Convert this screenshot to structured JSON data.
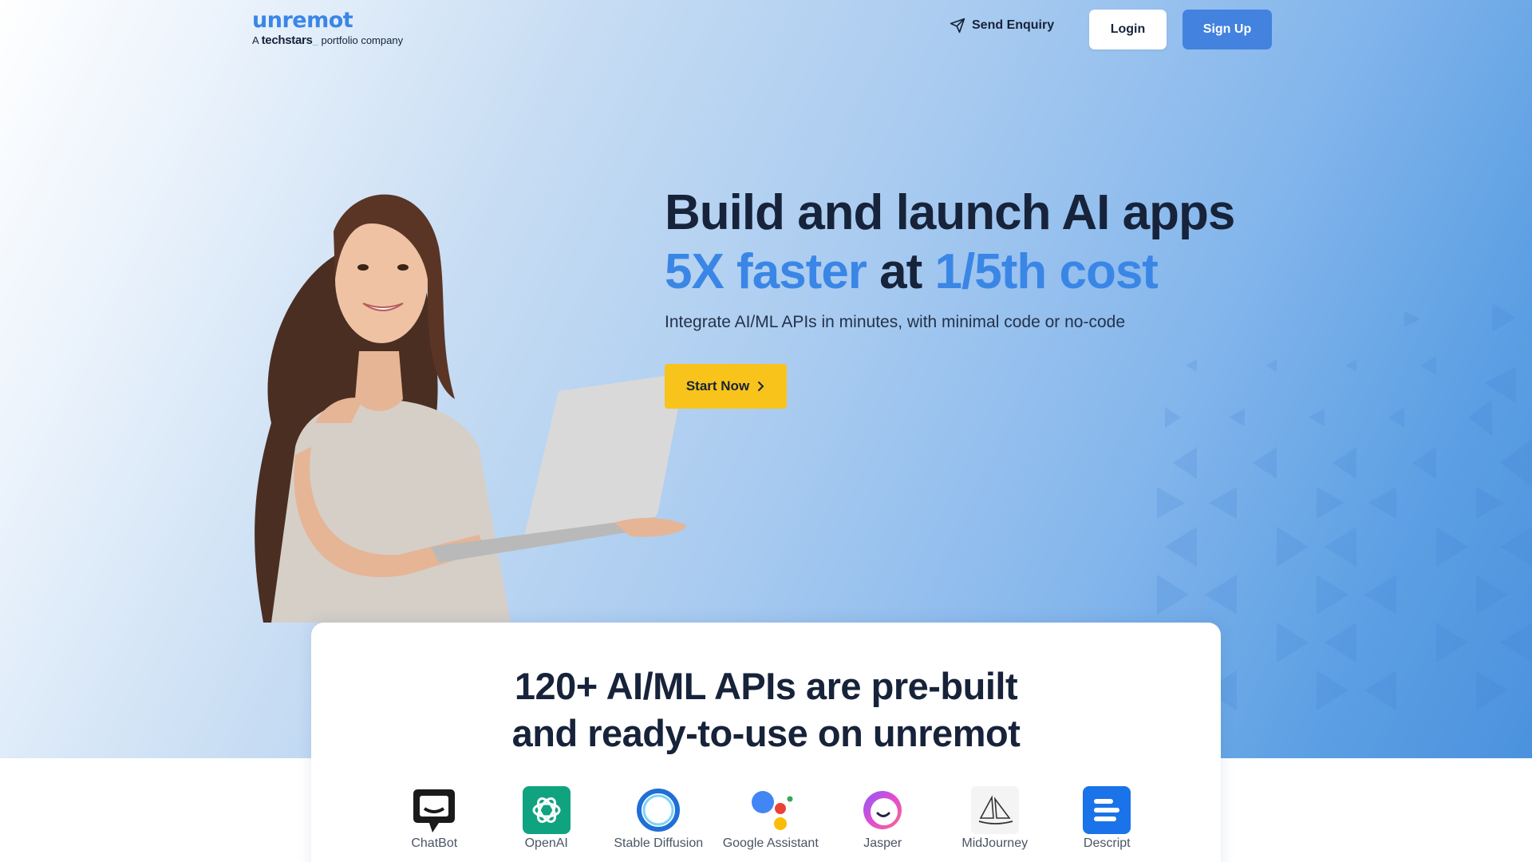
{
  "header": {
    "logo_word": "unremot",
    "logo_prefix": "A",
    "logo_techstars": "techstars",
    "logo_suffix": "portfolio company",
    "send_enquiry": "Send Enquiry",
    "login": "Login",
    "signup": "Sign Up"
  },
  "hero": {
    "headline_line1": "Build and launch AI apps",
    "headline_blue1": "5X faster",
    "headline_mid": " at ",
    "headline_blue2": "1/5th cost",
    "subhead": "Integrate AI/ML APIs in minutes, with minimal code or no-code",
    "cta": "Start Now"
  },
  "apis_section": {
    "title_line1": "120+ AI/ML APIs are pre-built",
    "title_line2": "and ready-to-use on unremot",
    "items": [
      {
        "name": "ChatBot",
        "icon": "chatbot-icon"
      },
      {
        "name": "OpenAI",
        "icon": "openai-icon"
      },
      {
        "name": "Stable Diffusion",
        "icon": "stable-diffusion-icon"
      },
      {
        "name": "Google Assistant",
        "icon": "google-assistant-icon"
      },
      {
        "name": "Jasper",
        "icon": "jasper-icon"
      },
      {
        "name": "MidJourney",
        "icon": "midjourney-icon"
      },
      {
        "name": "Descript",
        "icon": "descript-icon"
      }
    ]
  },
  "colors": {
    "brand_blue": "#3a86e6",
    "signup_blue": "#4382de",
    "cta_yellow": "#f8c31a",
    "text_dark": "#17233a"
  }
}
